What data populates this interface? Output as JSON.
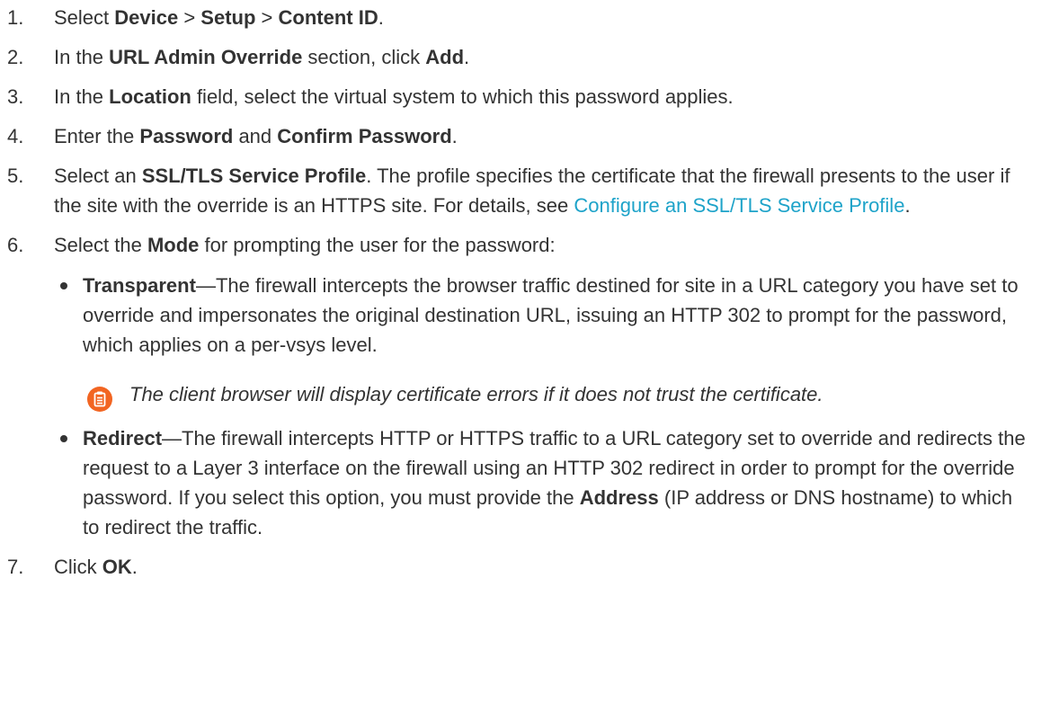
{
  "steps": [
    {
      "num": "1.",
      "t1": "Select ",
      "b1": "Device",
      "t2": " > ",
      "b2": "Setup",
      "t3": " > ",
      "b3": "Content ID",
      "t4": "."
    },
    {
      "num": "2.",
      "t1": "In the ",
      "b1": "URL Admin Override",
      "t2": " section, click ",
      "b2": "Add",
      "t3": "."
    },
    {
      "num": "3.",
      "t1": "In the ",
      "b1": "Location",
      "t2": " field, select the virtual system to which this password applies."
    },
    {
      "num": "4.",
      "t1": "Enter the ",
      "b1": "Password",
      "t2": " and ",
      "b2": "Confirm Password",
      "t3": "."
    },
    {
      "num": "5.",
      "t1": "Select an ",
      "b1": "SSL/TLS Service Profile",
      "t2": ". The profile specifies the certificate that the firewall presents to the user if the site with the override is an HTTPS site. For details, see ",
      "link": "Configure an SSL/TLS Service Profile",
      "t3": "."
    },
    {
      "num": "6.",
      "t1": "Select the ",
      "b1": "Mode",
      "t2": " for prompting the user for the password:",
      "bullets": [
        {
          "b": "Transparent",
          "t": "—The firewall intercepts the browser traffic destined for site in a URL category you have set to override and impersonates the original destination URL, issuing an HTTP 302 to prompt for the password, which applies on a per-vsys level."
        },
        {
          "b": "Redirect",
          "t1": "—The firewall intercepts HTTP or HTTPS traffic to a URL category set to override and redirects the request to a Layer 3 interface on the firewall using an HTTP 302 redirect in order to prompt for the override password. If you select this option, you must provide the ",
          "b2": "Address",
          "t2": " (IP address or DNS hostname) to which to redirect the traffic."
        }
      ],
      "note": {
        "icon": "clipboard-note-icon",
        "text": "The client browser will display certificate errors if it does not trust the certificate."
      }
    },
    {
      "num": "7.",
      "t1": "Click ",
      "b1": "OK",
      "t2": "."
    }
  ],
  "colors": {
    "text": "#333333",
    "link": "#1ea3c9",
    "note_icon": "#f26522"
  }
}
